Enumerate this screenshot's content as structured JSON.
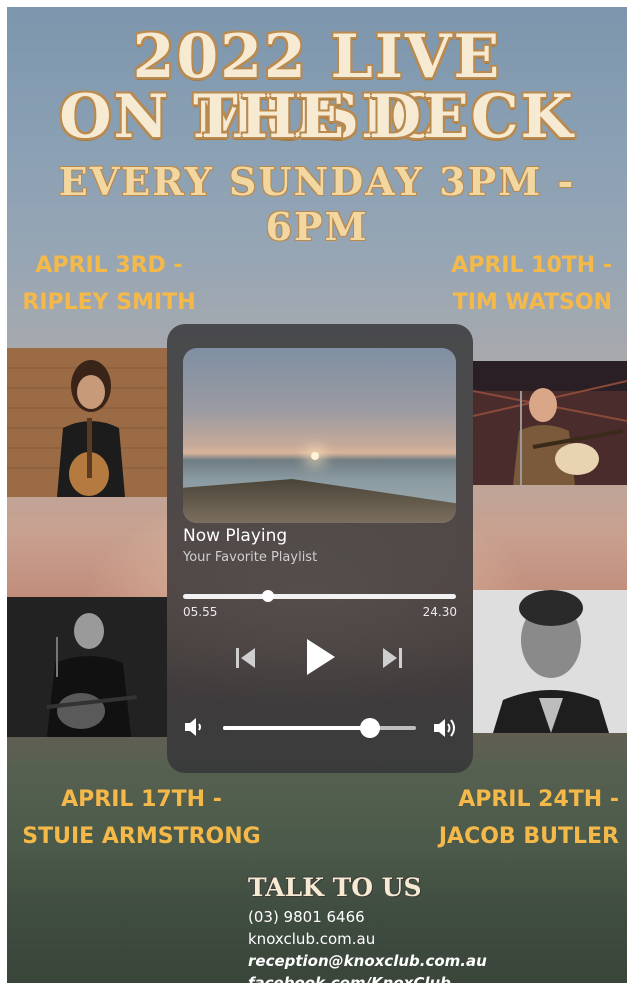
{
  "header": {
    "title_line1": "2022 LIVE MUSIC",
    "title_line2": "ON THE DECK",
    "subtitle": "EVERY SUNDAY 3PM - 6PM"
  },
  "acts": [
    {
      "date": "APRIL 3RD -",
      "name": "RIPLEY SMITH"
    },
    {
      "date": "APRIL 10TH -",
      "name": "TIM WATSON"
    },
    {
      "date": "APRIL 17TH -",
      "name": "STUIE ARMSTRONG"
    },
    {
      "date": "APRIL 24TH -",
      "name": "JACOB BUTLER"
    }
  ],
  "player": {
    "now_playing": "Now Playing",
    "playlist": "Your Favorite Playlist",
    "current_time": "05.55",
    "total_time": "24.30",
    "progress": 0.31,
    "volume": 0.76
  },
  "contact": {
    "title": "TALK TO US",
    "phone": "(03) 9801 6466",
    "website": "knoxclub.com.au",
    "email": "reception@knoxclub.com.au",
    "facebook": "facebook.com/KnoxClub"
  }
}
